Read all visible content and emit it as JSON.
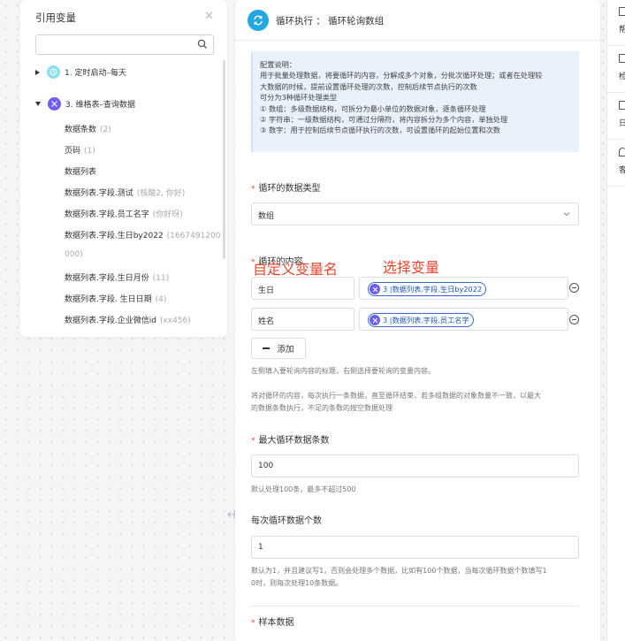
{
  "var_panel": {
    "title": "引用变量",
    "search_placeholder": "",
    "nodes": [
      {
        "label": "1. 定时启动–每天",
        "expanded": false
      },
      {
        "label": "3. 维格表–查询数据",
        "expanded": true
      }
    ],
    "children": [
      {
        "label": "数据条数",
        "sub": "(2)"
      },
      {
        "label": "页码",
        "sub": "(1)"
      },
      {
        "label": "数据列表",
        "sub": ""
      },
      {
        "label": "数据列表.字段.测试",
        "sub": "(核酸2, 你好)"
      },
      {
        "label": "数据列表.字段.员工名字",
        "sub": "(你好呀)"
      },
      {
        "label": "数据列表.字段.生日by2022",
        "sub": "(1667491200"
      },
      {
        "label": "000)",
        "sub": ""
      },
      {
        "label": "数据列表.字段.生日月份",
        "sub": "(11)"
      },
      {
        "label": "数据列表.字段. 生日日期",
        "sub": "(4)"
      },
      {
        "label": "数据列表.字段.企业微信id",
        "sub": "(xx456)"
      }
    ]
  },
  "main": {
    "title": "循环执行 ： 循环轮询数组",
    "info": [
      "配置说明：",
      "用于批量处理数据，将要循环的内容，分解成多个对象，分批次循环处理；或者在处理较",
      "大数据的时候，提前设置循环处理的次数，控制后续节点执行的次数",
      "可分为3种循环处理类型",
      "① 数组：多级数据结构，可拆分为最小单位的数据对象，逐条循环处理",
      "② 字符串：一级数据结构，可通过分隔符，将内容拆分为多个内容，单独处理",
      "③ 数字：用于控制后续节点循环执行的次数，可设置循环的起始位置和次数"
    ],
    "data_type_label": "循环的数据类型",
    "data_type_value": "数组",
    "content_label": "循环的内容",
    "annotation_left": "自定义变量名",
    "annotation_right": "选择变量",
    "rows": [
      {
        "name": "生日",
        "tag_prefix": "3 |",
        "tag": "数据列表.字段.生日by2022"
      },
      {
        "name": "姓名",
        "tag_prefix": "3 |",
        "tag": "数据列表.字段.员工名字"
      }
    ],
    "add_label": "添加",
    "hint_content": "左侧填入要轮询内容的标题，右侧选择要轮询的变量内容。",
    "hint_loop_1": "将对循环的内容，每次执行一条数据，直至循环结束，若多组数据的对象数量不一致，以最大",
    "hint_loop_2": "的数据条数执行，不足的条数的按空数据处理",
    "max_label": "最大循环数据条数",
    "max_value": "100",
    "max_hint": "默认处理100条，最多不超过500",
    "per_label": "每次循环数据个数",
    "per_value": "1",
    "per_hint_1": "默认为1，并且建议写1，否则会处理多个数据，比如有100个数据，当每次循环数据个数填写1",
    "per_hint_2": "0时，则每次处理10条数据。",
    "sample_label": "样本数据"
  },
  "right_rail": {
    "items": [
      "帮",
      "检",
      "日",
      "客"
    ]
  },
  "colors": {
    "accent": "#23a7e3",
    "required": "#e94646",
    "tag_border": "#2f6fd8",
    "annotation": "#e8472e",
    "info_bg": "#e9f1fd"
  }
}
